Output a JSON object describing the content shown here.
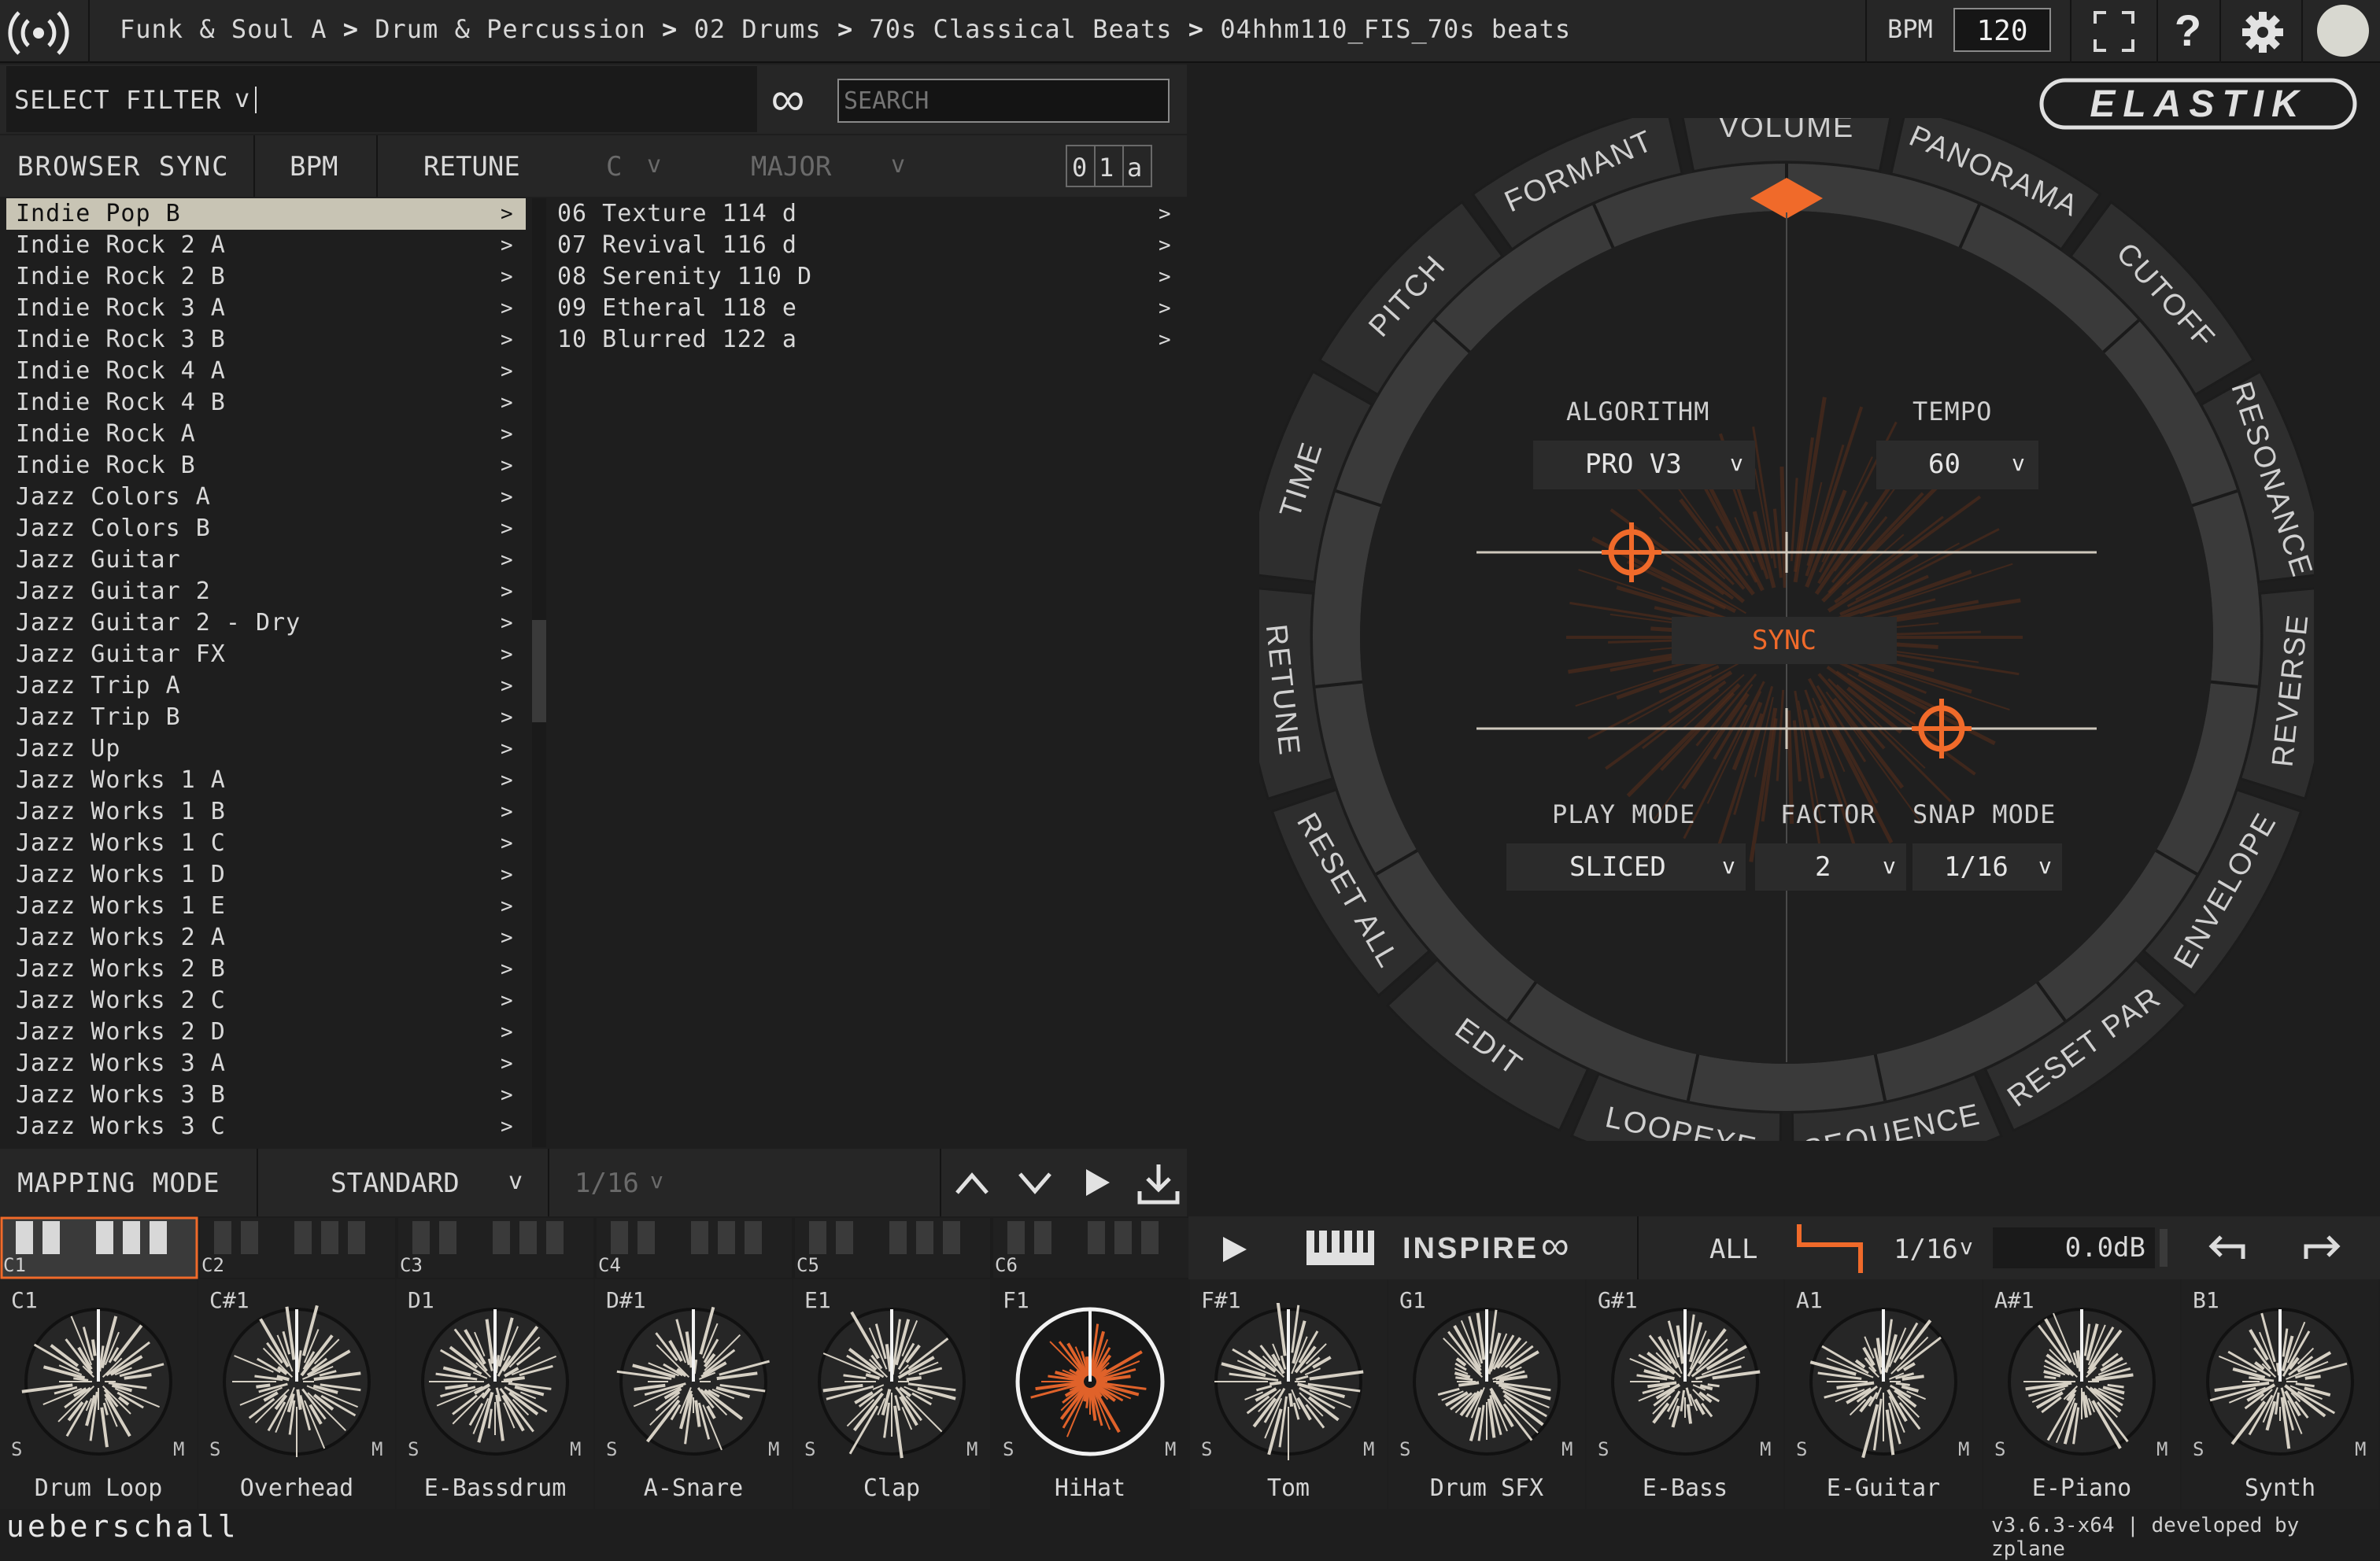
{
  "topbar": {
    "breadcrumb": [
      "Funk & Soul A",
      "Drum & Percussion",
      "02 Drums",
      "70s Classical Beats",
      "04hhm110_FIS_70s beats"
    ],
    "sep": ">",
    "bpm_label": "BPM",
    "bpm_value": "120",
    "help": "?"
  },
  "filter": {
    "select_label": "SELECT FILTER",
    "select_caret": "v",
    "infinity": "∞",
    "search_placeholder": "SEARCH"
  },
  "controls": {
    "browser_sync": "BROWSER SYNC",
    "bpm": "BPM",
    "retune": "RETUNE",
    "key": "C",
    "key_caret": "v",
    "scale": "MAJOR",
    "scale_caret": "v",
    "toggle": [
      "0",
      "1",
      "a"
    ]
  },
  "styles": [
    "Indie Pop B",
    "Indie Rock 2 A",
    "Indie Rock 2 B",
    "Indie Rock 3 A",
    "Indie Rock 3 B",
    "Indie Rock 4 A",
    "Indie Rock 4 B",
    "Indie Rock A",
    "Indie Rock B",
    "Jazz Colors A",
    "Jazz Colors B",
    "Jazz Guitar",
    "Jazz Guitar 2",
    "Jazz Guitar 2 - Dry",
    "Jazz Guitar FX",
    "Jazz Trip A",
    "Jazz Trip B",
    "Jazz Up",
    "Jazz Works 1 A",
    "Jazz Works 1 B",
    "Jazz Works 1 C",
    "Jazz Works 1 D",
    "Jazz Works 1 E",
    "Jazz Works 2 A",
    "Jazz Works 2 B",
    "Jazz Works 2 C",
    "Jazz Works 2 D",
    "Jazz Works 3 A",
    "Jazz Works 3 B",
    "Jazz Works 3 C"
  ],
  "styles_selected": 0,
  "row_arrow": ">",
  "files": [
    "06 Texture 114 d",
    "07 Revival 116 d",
    "08 Serenity 110 D",
    "09 Etheral 118 e",
    "10 Blurred 122 a"
  ],
  "mapping": {
    "label": "MAPPING MODE",
    "mode": "STANDARD",
    "mode_caret": "v",
    "grid": "1/16",
    "grid_caret": "v"
  },
  "elastik": {
    "logo": "ELASTIK",
    "ring_labels": [
      "VOLUME",
      "PANORAMA",
      "CUTOFF",
      "RESONANCE",
      "REVERSE",
      "ENVELOPE",
      "RESET PAR",
      "SEQUENCE",
      "LOOPEYE",
      "EDIT",
      "RESET ALL",
      "RETUNE",
      "TIME",
      "PITCH",
      "FORMANT"
    ],
    "active_labels": [
      "TIME",
      "EDIT"
    ],
    "algorithm_label": "ALGORITHM",
    "algorithm": "PRO V3",
    "tempo_label": "TEMPO",
    "tempo": "60",
    "sync": "SYNC",
    "play_mode_label": "PLAY MODE",
    "play_mode": "SLICED",
    "factor_label": "FACTOR",
    "factor": "2",
    "snap_mode_label": "SNAP MODE",
    "snap_mode": "1/16",
    "caret": "v",
    "slider1_pos": 0.25,
    "slider2_pos": 0.75
  },
  "keyboard": {
    "octaves": [
      "C1",
      "C2",
      "C3",
      "C4",
      "C5",
      "C6"
    ]
  },
  "pads_bar": {
    "inspire": "INSPIRE",
    "infinity": "∞",
    "all": "ALL",
    "grid": "1/16",
    "grid_caret": "v",
    "gain": "0.0dB"
  },
  "pads": [
    {
      "note": "C1",
      "name": "Drum Loop"
    },
    {
      "note": "C#1",
      "name": "Overhead"
    },
    {
      "note": "D1",
      "name": "E-Bassdrum"
    },
    {
      "note": "D#1",
      "name": "A-Snare"
    },
    {
      "note": "E1",
      "name": "Clap"
    },
    {
      "note": "F1",
      "name": "HiHat"
    },
    {
      "note": "F#1",
      "name": "Tom"
    },
    {
      "note": "G1",
      "name": "Drum SFX"
    },
    {
      "note": "G#1",
      "name": "E-Bass"
    },
    {
      "note": "A1",
      "name": "E-Guitar"
    },
    {
      "note": "A#1",
      "name": "E-Piano"
    },
    {
      "note": "B1",
      "name": "Synth"
    }
  ],
  "pad_selected": 5,
  "pad_s": "S",
  "pad_m": "M",
  "footer": {
    "brand": "ueberschall",
    "version": "v3.6.3-x64 | developed by zplane"
  },
  "colors": {
    "accent": "#f06a2a",
    "bg": "#1e1e1e",
    "panel": "#262626",
    "selected_row": "#c8c4b4"
  }
}
